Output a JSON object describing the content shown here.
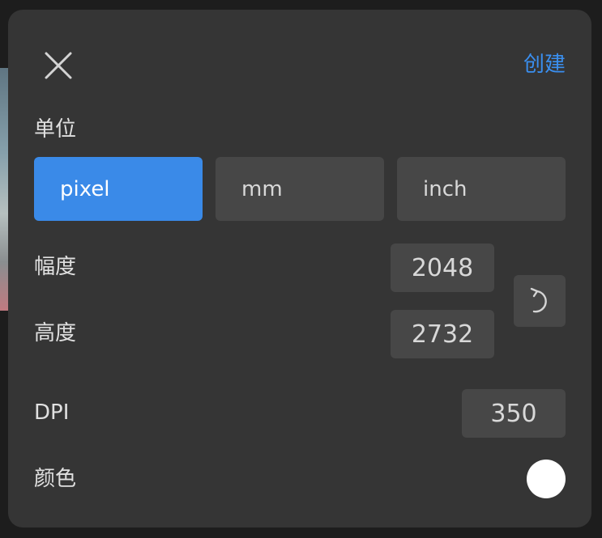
{
  "dialog": {
    "close_icon": "close-icon",
    "create_label": "创建",
    "accent_color": "#3a8ff0"
  },
  "unit": {
    "label": "单位",
    "options": [
      "pixel",
      "mm",
      "inch"
    ],
    "selected": "pixel"
  },
  "size": {
    "width_label": "幅度",
    "width_value": "2048",
    "height_label": "高度",
    "height_value": "2732",
    "swap_icon": "rotate-icon"
  },
  "dpi": {
    "label": "DPI",
    "value": "350"
  },
  "color": {
    "label": "颜色",
    "value": "#ffffff"
  }
}
